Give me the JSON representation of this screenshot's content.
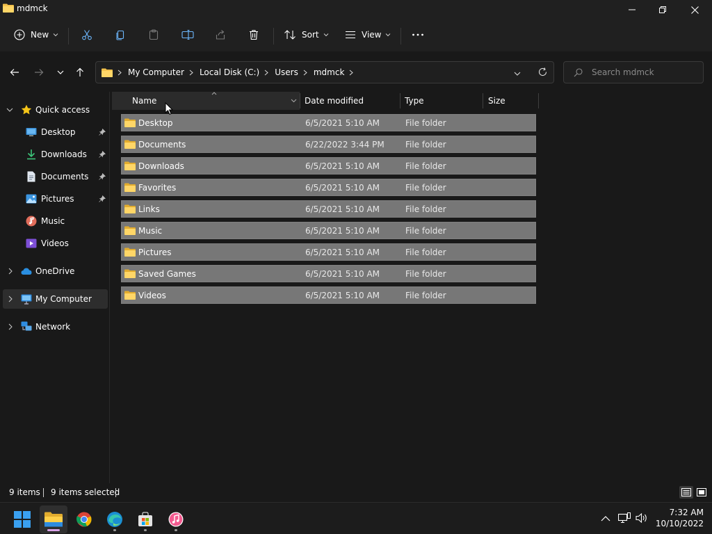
{
  "window": {
    "title": "mdmck",
    "icons": {
      "app": "folder-icon",
      "minimize": "minimize-icon",
      "restore": "restore-icon",
      "close": "close-icon"
    }
  },
  "command_bar": {
    "new_label": "New",
    "sort_label": "Sort",
    "view_label": "View",
    "icons": [
      "plus-icon",
      "cut-icon",
      "copy-icon",
      "paste-icon",
      "rename-icon",
      "share-icon",
      "delete-icon",
      "sort-icon",
      "view-icon",
      "more-icon"
    ]
  },
  "address": {
    "breadcrumbs": [
      "My Computer",
      "Local Disk (C:)",
      "Users",
      "mdmck"
    ],
    "search_placeholder": "Search mdmck"
  },
  "sidebar": {
    "quick_access": {
      "label": "Quick access",
      "items": [
        {
          "label": "Desktop",
          "icon": "desktop-icon",
          "pinned": true
        },
        {
          "label": "Downloads",
          "icon": "download-icon",
          "pinned": true
        },
        {
          "label": "Documents",
          "icon": "document-icon",
          "pinned": true
        },
        {
          "label": "Pictures",
          "icon": "pictures-icon",
          "pinned": true
        },
        {
          "label": "Music",
          "icon": "music-icon",
          "pinned": false
        },
        {
          "label": "Videos",
          "icon": "video-icon",
          "pinned": false
        }
      ]
    },
    "onedrive": "OneDrive",
    "my_computer": "My Computer",
    "network": "Network"
  },
  "columns": {
    "name": "Name",
    "date": "Date modified",
    "type": "Type",
    "size": "Size"
  },
  "files": [
    {
      "name": "Desktop",
      "date": "6/5/2021 5:10 AM",
      "type": "File folder"
    },
    {
      "name": "Documents",
      "date": "6/22/2022 3:44 PM",
      "type": "File folder"
    },
    {
      "name": "Downloads",
      "date": "6/5/2021 5:10 AM",
      "type": "File folder"
    },
    {
      "name": "Favorites",
      "date": "6/5/2021 5:10 AM",
      "type": "File folder"
    },
    {
      "name": "Links",
      "date": "6/5/2021 5:10 AM",
      "type": "File folder"
    },
    {
      "name": "Music",
      "date": "6/5/2021 5:10 AM",
      "type": "File folder"
    },
    {
      "name": "Pictures",
      "date": "6/5/2021 5:10 AM",
      "type": "File folder"
    },
    {
      "name": "Saved Games",
      "date": "6/5/2021 5:10 AM",
      "type": "File folder"
    },
    {
      "name": "Videos",
      "date": "6/5/2021 5:10 AM",
      "type": "File folder"
    }
  ],
  "status": {
    "item_count": "9 items",
    "selected": "9 items selected"
  },
  "taskbar": {
    "apps": [
      "start-icon",
      "file-explorer-icon",
      "chrome-icon",
      "edge-icon",
      "store-icon",
      "itunes-icon"
    ],
    "time": "7:32 AM",
    "date": "10/10/2022"
  },
  "colors": {
    "accent": "#4cc2ff",
    "selection_row": "#777777",
    "folder": "#f3c14b"
  }
}
